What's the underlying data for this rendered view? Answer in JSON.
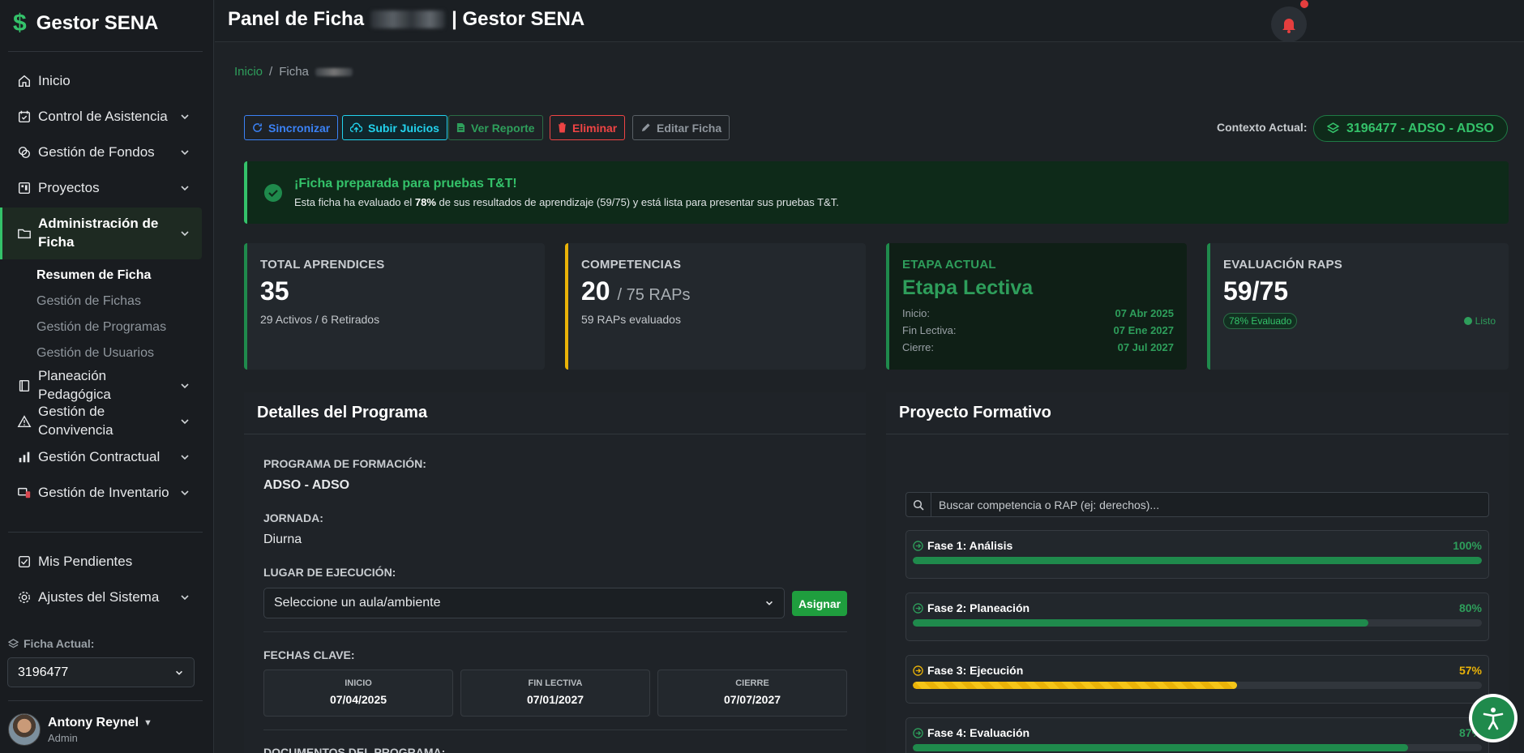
{
  "brand": {
    "name": "Gestor SENA"
  },
  "topbar": {
    "title_prefix": "Panel de Ficha",
    "title_suffix": "| Gestor SENA"
  },
  "sidebar": {
    "items": [
      {
        "label": "Inicio",
        "icon": "home-icon",
        "has_chevron": false
      },
      {
        "label": "Control de Asistencia",
        "icon": "calendar-check-icon",
        "has_chevron": true
      },
      {
        "label": "Gestión de Fondos",
        "icon": "coins-icon",
        "has_chevron": true
      },
      {
        "label": "Proyectos",
        "icon": "project-icon",
        "has_chevron": true
      },
      {
        "label": "Administración de Ficha",
        "icon": "folder-icon",
        "has_chevron": true,
        "active": true
      },
      {
        "label": "Planeación Pedagógica",
        "icon": "book-icon",
        "has_chevron": true
      },
      {
        "label": "Gestión de Convivencia",
        "icon": "warning-icon",
        "has_chevron": true
      },
      {
        "label": "Gestión Contractual",
        "icon": "bar-chart-icon",
        "has_chevron": true
      },
      {
        "label": "Gestión de Inventario",
        "icon": "devices-icon",
        "has_chevron": true
      },
      {
        "label": "Mis Pendientes",
        "icon": "checkbox-icon",
        "has_chevron": false
      },
      {
        "label": "Ajustes del Sistema",
        "icon": "gear-icon",
        "has_chevron": true
      }
    ],
    "subitems": [
      "Resumen de Ficha",
      "Gestión de Fichas",
      "Gestión de Programas",
      "Gestión de Usuarios"
    ],
    "ficha_label": "Ficha Actual:",
    "ficha_value": "3196477"
  },
  "user": {
    "name": "Antony Reynel",
    "role": "Admin"
  },
  "breadcrumb": {
    "home": "Inicio",
    "sep": "/",
    "current": "Ficha"
  },
  "actions": {
    "sync": "Sincronizar",
    "subir": "Subir Juicios",
    "report": "Ver Reporte",
    "delete": "Eliminar",
    "edit": "Editar Ficha"
  },
  "context": {
    "label": "Contexto Actual:",
    "value": "3196477 - ADSO - ADSO"
  },
  "alert": {
    "title": "¡Ficha preparada para pruebas T&T!",
    "body_pre": "Esta ficha ha evaluado el ",
    "body_bold": "78%",
    "body_post": " de sus resultados de aprendizaje (59/75) y está lista para presentar sus pruebas T&T."
  },
  "stats": {
    "aprendices": {
      "label": "TOTAL APRENDICES",
      "value": "35",
      "sub": "29 Activos / 6 Retirados"
    },
    "competencias": {
      "label": "COMPETENCIAS",
      "value": "20",
      "value_suffix": "/ 75 RAPs",
      "sub": "59 RAPs evaluados"
    },
    "etapa": {
      "label": "ETAPA ACTUAL",
      "value": "Etapa Lectiva",
      "rows": [
        {
          "k": "Inicio:",
          "v": "07 Abr 2025"
        },
        {
          "k": "Fin Lectiva:",
          "v": "07 Ene 2027"
        },
        {
          "k": "Cierre:",
          "v": "07 Jul 2027"
        }
      ]
    },
    "raps": {
      "label": "EVALUACIÓN RAPS",
      "value": "59/75",
      "badge": "78% Evaluado",
      "status": "Listo"
    }
  },
  "programa": {
    "title": "Detalles del Programa",
    "programa_label": "PROGRAMA DE FORMACIÓN:",
    "programa_value": "ADSO - ADSO",
    "jornada_label": "JORNADA:",
    "jornada_value": "Diurna",
    "lugar_label": "LUGAR DE EJECUCIÓN:",
    "lugar_placeholder": "Seleccione un aula/ambiente",
    "asignar": "Asignar",
    "fechas_label": "FECHAS CLAVE:",
    "fechas": [
      {
        "label": "INICIO",
        "value": "07/04/2025"
      },
      {
        "label": "FIN LECTIVA",
        "value": "07/01/2027"
      },
      {
        "label": "CIERRE",
        "value": "07/07/2027"
      }
    ],
    "documentos_label": "DOCUMENTOS DEL PROGRAMA:"
  },
  "proyecto": {
    "title": "Proyecto Formativo",
    "search_placeholder": "Buscar competencia o RAP (ej: derechos)...",
    "phases": [
      {
        "name": "Fase 1: Análisis",
        "pct_label": "100%",
        "pct": 100,
        "status": "ok"
      },
      {
        "name": "Fase 2: Planeación",
        "pct_label": "80%",
        "pct": 80,
        "status": "ok"
      },
      {
        "name": "Fase 3: Ejecución",
        "pct_label": "57%",
        "pct": 57,
        "status": "warn"
      },
      {
        "name": "Fase 4: Evaluación",
        "pct_label": "87%",
        "pct": 87,
        "status": "ok"
      }
    ]
  },
  "colors": {
    "accent": "#34c26a",
    "warning": "#eab308",
    "danger": "#ef4444",
    "info": "#3b82f6",
    "cyan": "#22d3ee"
  }
}
